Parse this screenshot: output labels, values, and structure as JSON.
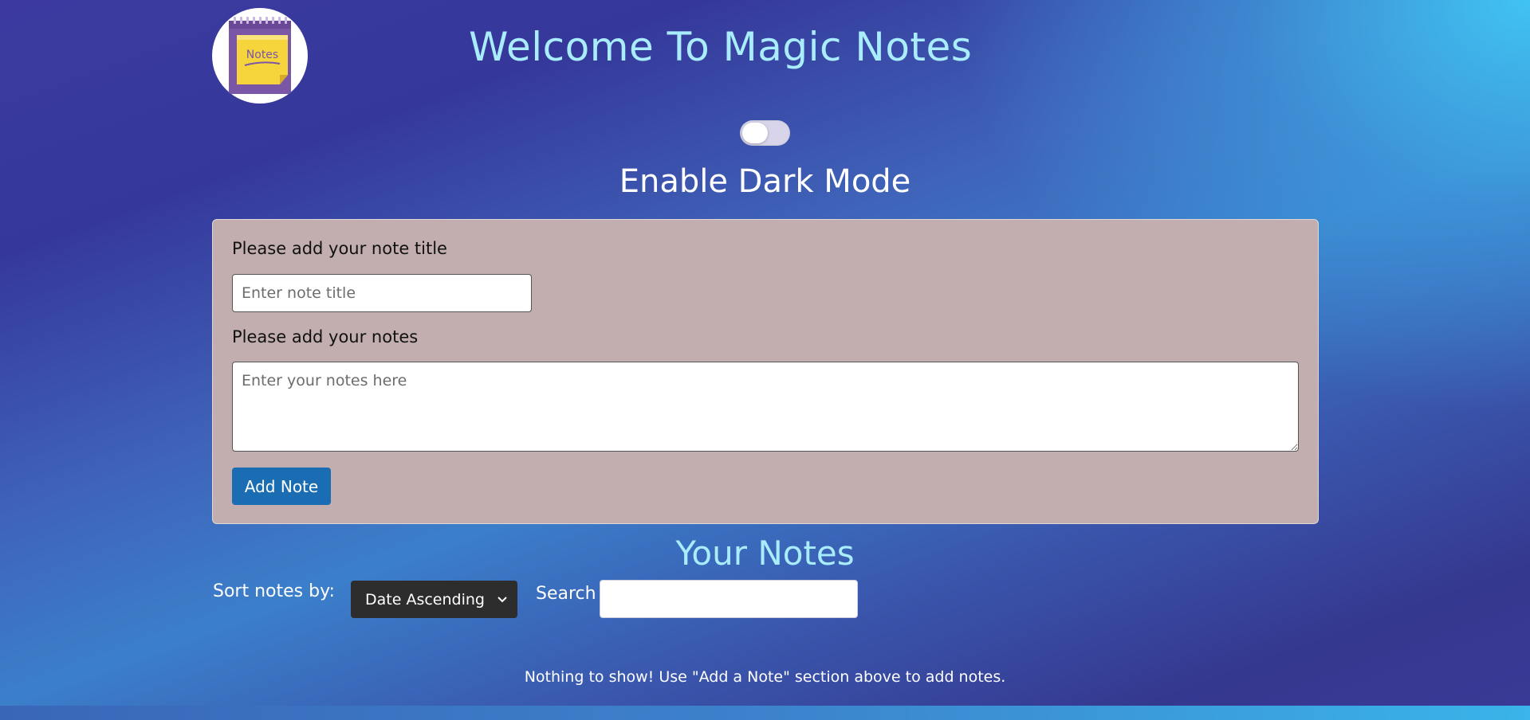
{
  "header": {
    "title": "Welcome To Magic Notes",
    "logo_text": "Notes",
    "dark_mode_label": "Enable Dark Mode",
    "dark_mode_enabled": false
  },
  "form": {
    "title_label": "Please add your note title",
    "title_placeholder": "Enter note title",
    "title_value": "",
    "notes_label": "Please add your notes",
    "notes_placeholder": "Enter your notes here",
    "notes_value": "",
    "add_button_label": "Add Note"
  },
  "notes_section": {
    "heading": "Your Notes",
    "sort_label": "Sort notes by:",
    "sort_selected": "Date Ascending",
    "search_label": "Search",
    "search_value": "",
    "empty_message": "Nothing to show! Use \"Add a Note\" section above to add notes."
  },
  "colors": {
    "title_color": "#a9ecfb",
    "card_bg": "#c2aeae",
    "button_bg": "#1a6db3",
    "select_bg": "#2d2d2d",
    "logo_note_yellow": "#f6d43c",
    "logo_pad_purple": "#7a56a6"
  }
}
